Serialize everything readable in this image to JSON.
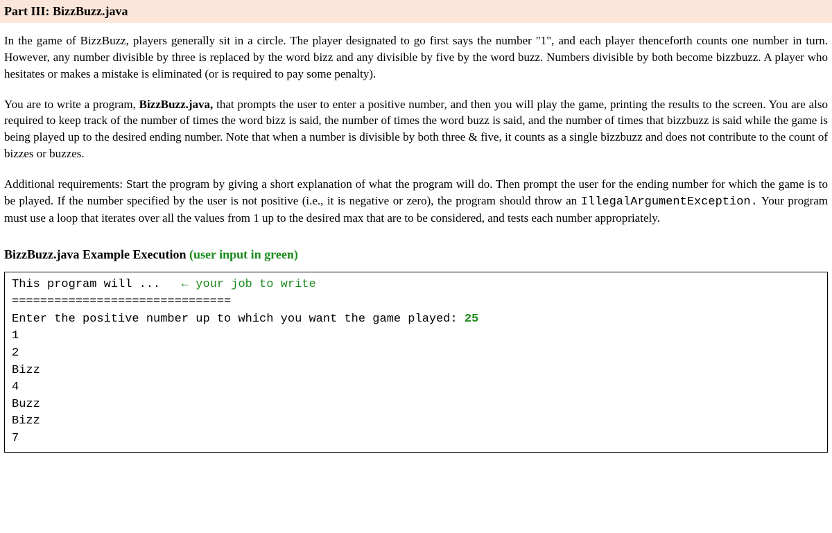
{
  "header": {
    "title": "Part III: BizzBuzz.java"
  },
  "paragraphs": {
    "p1": "In the game of BizzBuzz, players generally sit in a circle. The player designated to go first says the number \"1\", and each player thenceforth counts one number in turn. However, any number divisible by three is replaced by the word bizz and any divisible by five by the word buzz. Numbers divisible by both become bizzbuzz. A player who hesitates or makes a mistake is eliminated (or is required to pay some penalty).",
    "p2_prefix": "You are to write a program, ",
    "p2_bold": "BizzBuzz.java,",
    "p2_suffix": " that prompts the user to enter a positive number, and then you will play the game, printing the results to the screen. You are also required to keep track of  the number of times the word bizz is said, the number of times the word buzz is said, and the number of times that bizzbuzz is said while the game is being played up to the desired ending number. Note that when a number is divisible by both three & five, it counts as a single bizzbuzz and does not contribute to the count of bizzes or buzzes.",
    "p3_prefix": "Additional requirements: Start the program by giving a short explanation of what the program will do. Then prompt the user for the ending number for which the game is to be played.  If the number specified by the user is not positive (i.e., it is negative or zero), the program should throw an ",
    "p3_mono": "IllegalArgumentException.",
    "p3_suffix": " Your program must use a loop that iterates over all the values from 1 up to the desired max that are to be considered, and tests each number appropriately."
  },
  "example": {
    "heading_main": "BizzBuzz.java Example Execution ",
    "heading_green": "(user input in green)",
    "line1_text": "This program will ...   ",
    "line1_annotation": "← your job to write",
    "divider": "===============================",
    "prompt": "Enter the positive number up to which you want the game played: ",
    "user_input": "25",
    "output_lines": [
      "1",
      "2",
      "Bizz",
      "4",
      "Buzz",
      "Bizz",
      "7"
    ]
  }
}
